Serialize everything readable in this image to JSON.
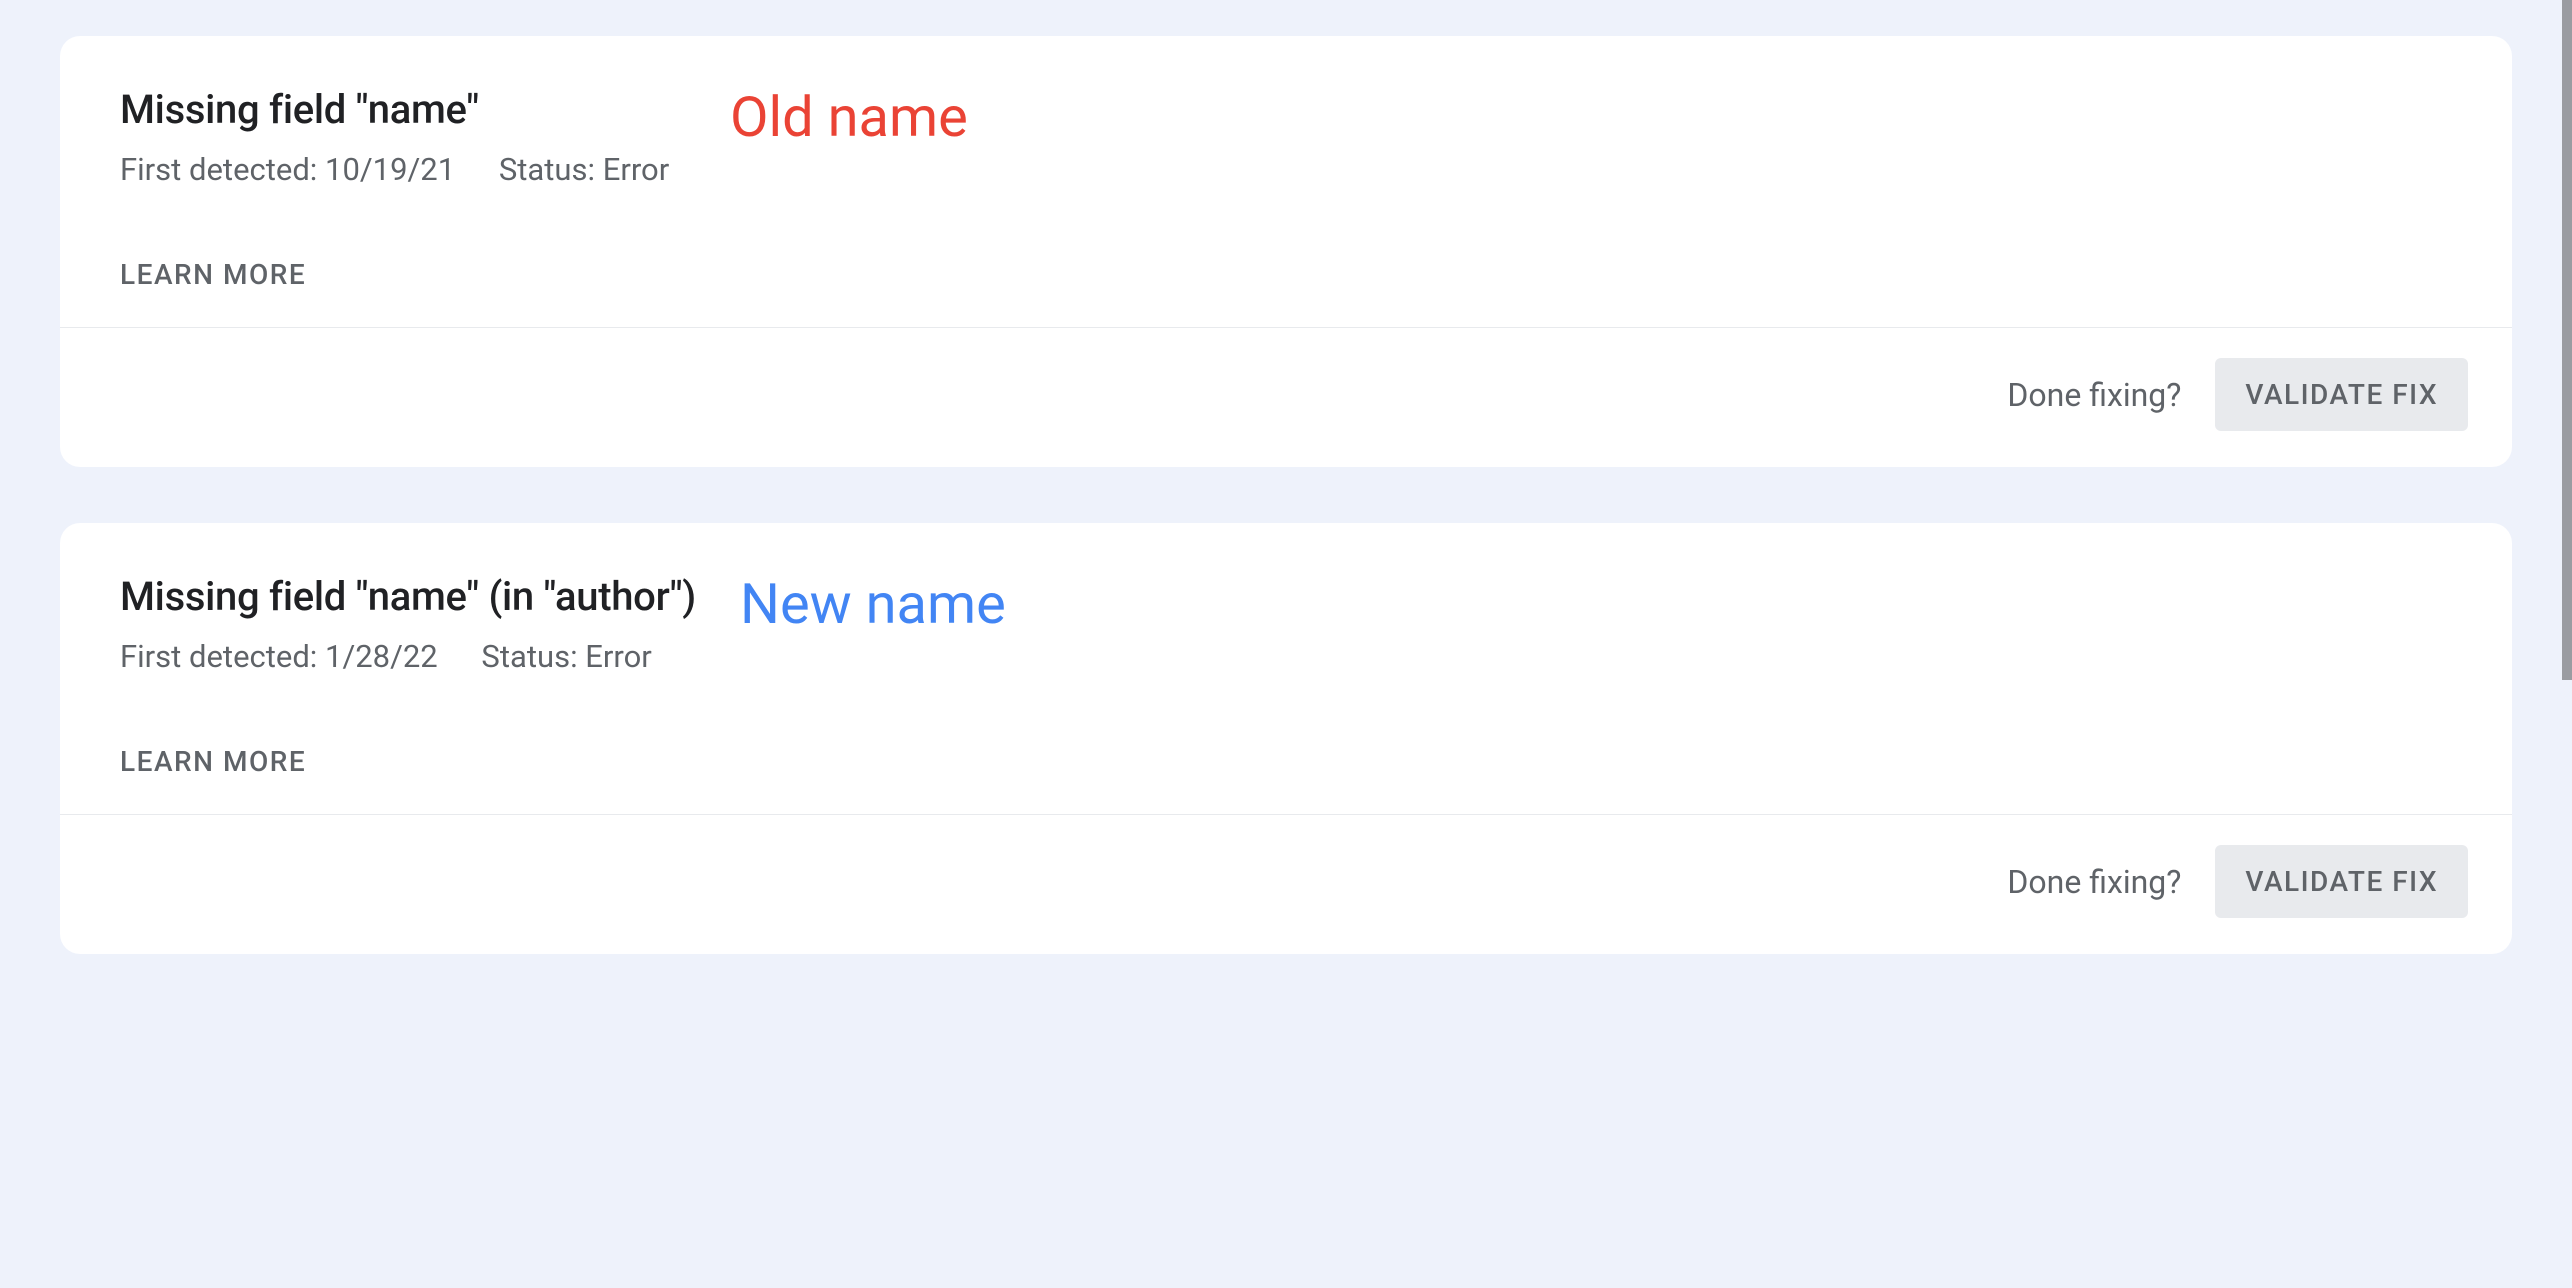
{
  "cards": [
    {
      "title": "Missing field \"name\"",
      "first_detected_label": "First detected:",
      "first_detected_value": "10/19/21",
      "status_label": "Status:",
      "status_value": "Error",
      "annotation": "Old name",
      "learn_more": "LEARN MORE",
      "done_fixing": "Done fixing?",
      "validate_fix": "VALIDATE FIX"
    },
    {
      "title": "Missing field \"name\" (in \"author\")",
      "first_detected_label": "First detected:",
      "first_detected_value": "1/28/22",
      "status_label": "Status:",
      "status_value": "Error",
      "annotation": "New name",
      "learn_more": "LEARN MORE",
      "done_fixing": "Done fixing?",
      "validate_fix": "VALIDATE FIX"
    }
  ]
}
